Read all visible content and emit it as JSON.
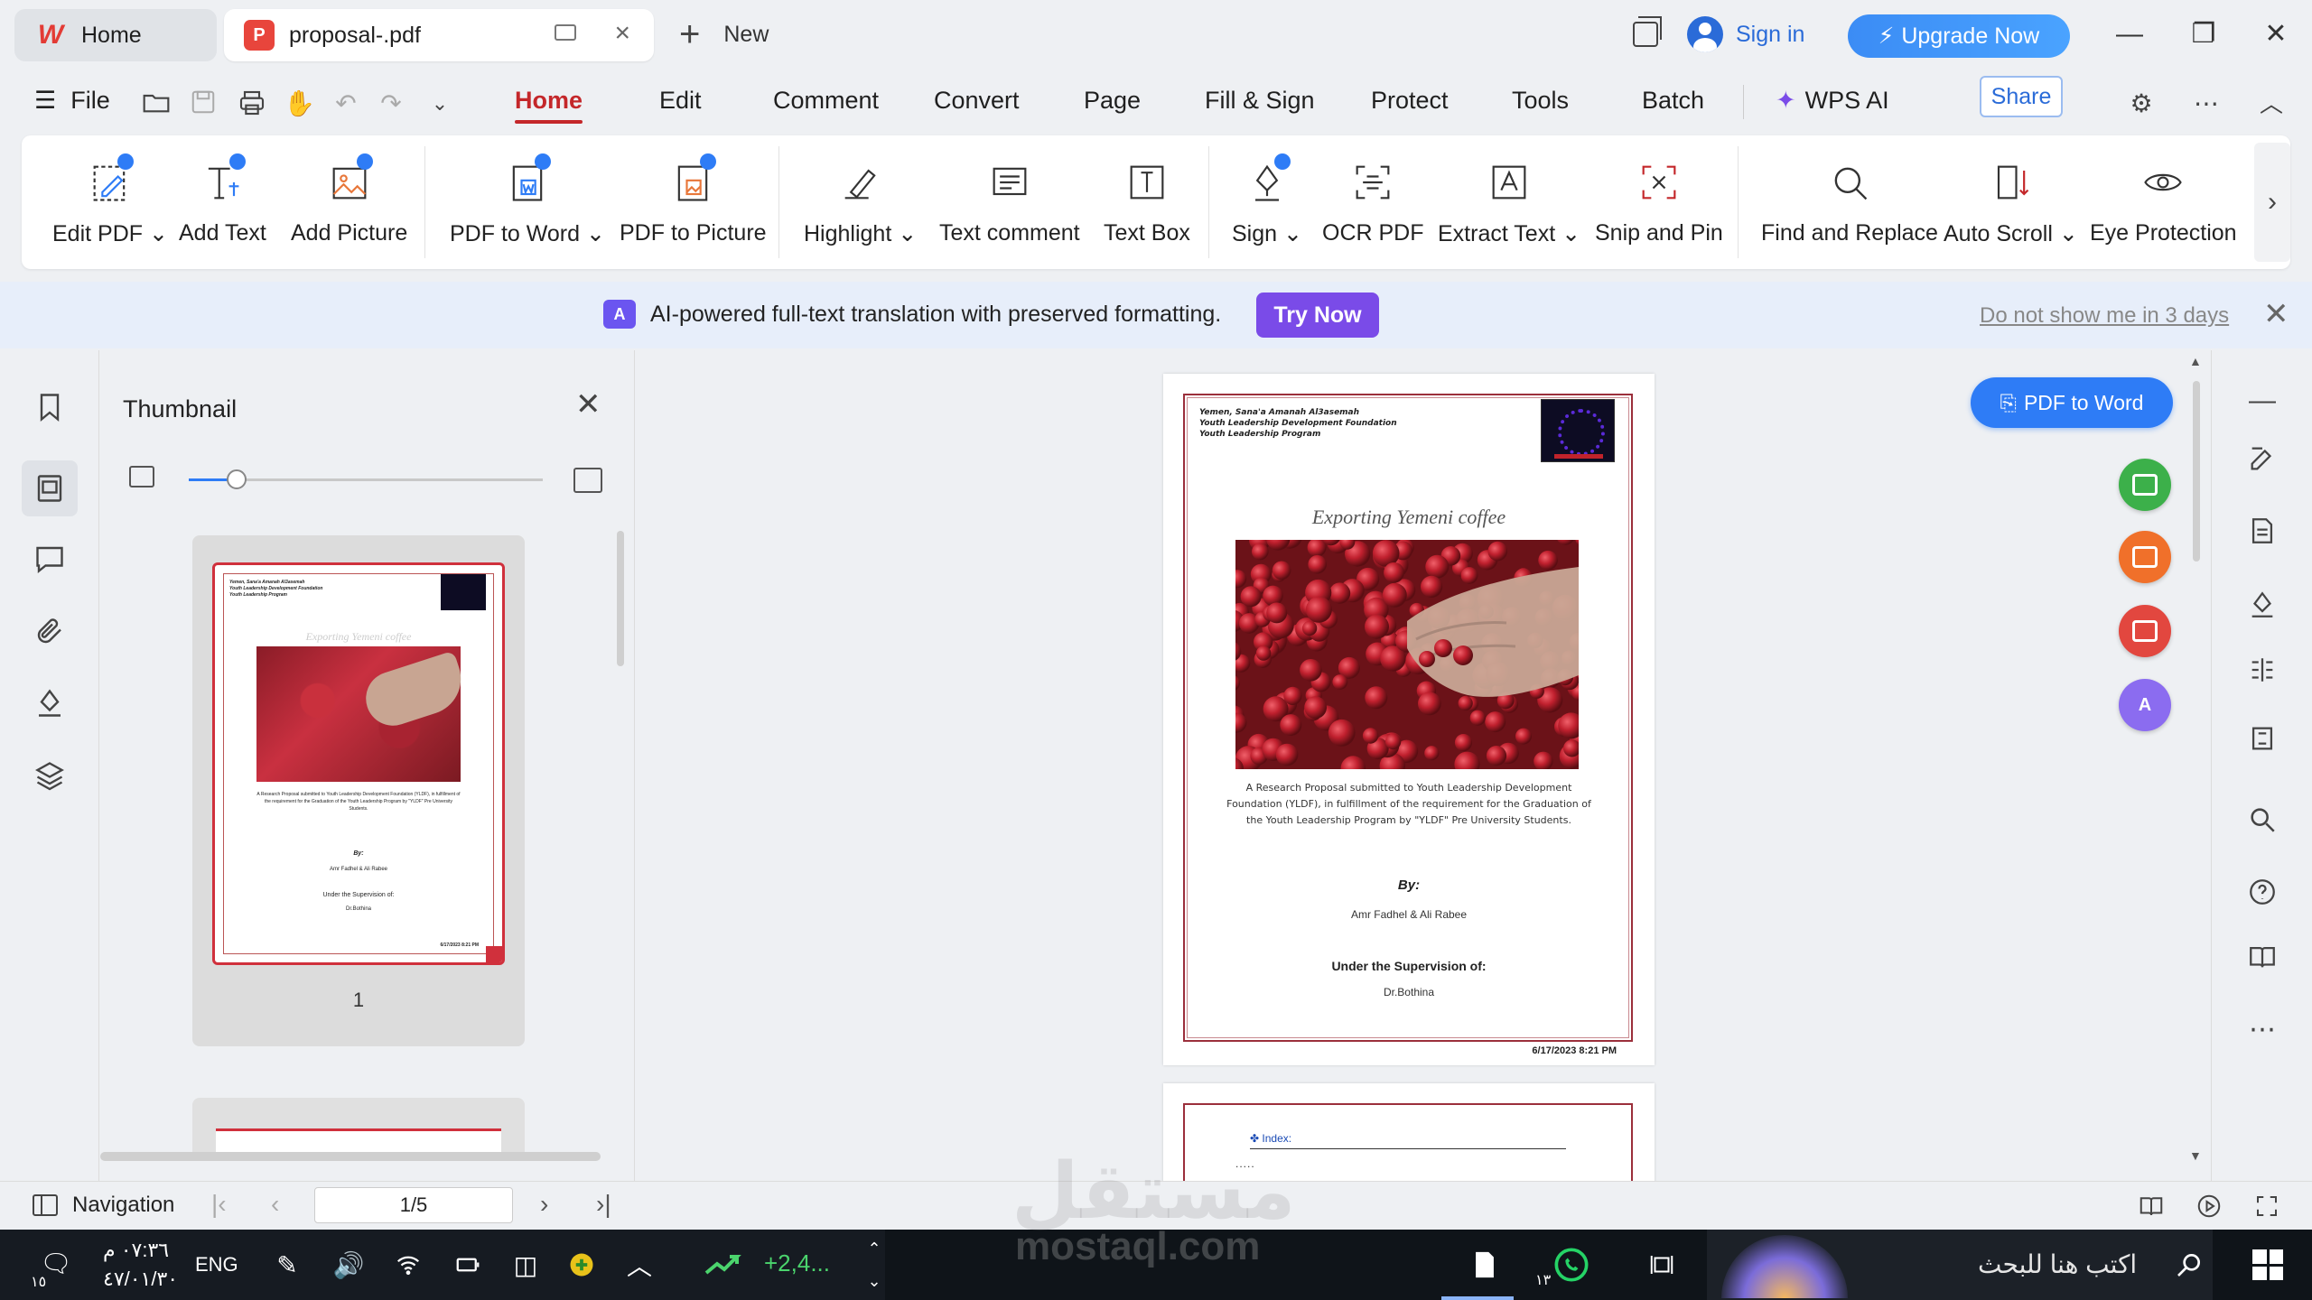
{
  "titlebar": {
    "tabs": [
      {
        "label": "Home",
        "icon": "wps-logo-icon"
      },
      {
        "label": "proposal-.pdf",
        "icon": "pdf-logo-icon"
      }
    ],
    "new_tab_label": "New",
    "sign_in_label": "Sign in",
    "upgrade_label": "Upgrade Now"
  },
  "menubar": {
    "file_label": "File",
    "items": [
      "Home",
      "Edit",
      "Comment",
      "Convert",
      "Page",
      "Fill & Sign",
      "Protect",
      "Tools",
      "Batch"
    ],
    "active": "Home",
    "wps_ai_label": "WPS AI",
    "share_label": "Share"
  },
  "ribbon": {
    "buttons": [
      {
        "label": "Edit PDF",
        "dropdown": true
      },
      {
        "label": "Add Text"
      },
      {
        "label": "Add Picture"
      },
      {
        "label": "PDF to Word",
        "dropdown": true
      },
      {
        "label": "PDF to Picture"
      },
      {
        "label": "Highlight",
        "dropdown": true
      },
      {
        "label": "Text comment"
      },
      {
        "label": "Text Box"
      },
      {
        "label": "Sign",
        "dropdown": true
      },
      {
        "label": "OCR PDF"
      },
      {
        "label": "Extract Text",
        "dropdown": true
      },
      {
        "label": "Snip and Pin"
      },
      {
        "label": "Find and Replace"
      },
      {
        "label": "Auto Scroll",
        "dropdown": true
      },
      {
        "label": "Eye Protection"
      }
    ]
  },
  "banner": {
    "text": "AI-powered full-text translation with preserved formatting.",
    "button_label": "Try Now",
    "dismiss_label": "Do not show me in 3 days"
  },
  "thumbnail_panel": {
    "title": "Thumbnail",
    "page_number": "1",
    "zoom_level": 0.1
  },
  "document": {
    "header_lines": [
      "Yemen, Sana'a Amanah Al3asemah",
      "Youth Leadership Development Foundation",
      "Youth Leadership Program"
    ],
    "title": "Exporting Yemeni coffee",
    "subtitle": "A Research Proposal submitted to Youth Leadership Development Foundation (YLDF), in fulfillment of the requirement for the Graduation of the Youth Leadership Program by \"YLDF\" Pre University Students.",
    "by_label": "By:",
    "authors": "Amr Fadhel & Ali Rabee",
    "supervision_label": "Under the Supervision of:",
    "supervisor": "Dr.Bothina",
    "date": "6/17/2023 8:21 PM",
    "page2_index_label": "Index:",
    "page2_dots": "....."
  },
  "floating": {
    "pdf_to_word_label": "PDF to Word",
    "fab_colors": [
      "#3cb04a",
      "#f0702a",
      "#e2473f",
      "#8b6cf0"
    ]
  },
  "statusbar": {
    "navigation_label": "Navigation",
    "page_indicator": "1/5"
  },
  "taskbar": {
    "time": "٠٧:٣٦ م",
    "date": "٤٧/٠١/٣٠",
    "language": "ENG",
    "notification_count": "١٥",
    "stock_value": "+2,4...",
    "whatsapp_count": "١٣",
    "search_placeholder": "اكتب هنا للبحث"
  },
  "watermark": {
    "arabic": "مستقل",
    "latin": "mostaql.com"
  },
  "colors": {
    "accent_red": "#c4272a",
    "primary_blue": "#2e7cf6",
    "try_now_purple": "#7a4be8"
  }
}
